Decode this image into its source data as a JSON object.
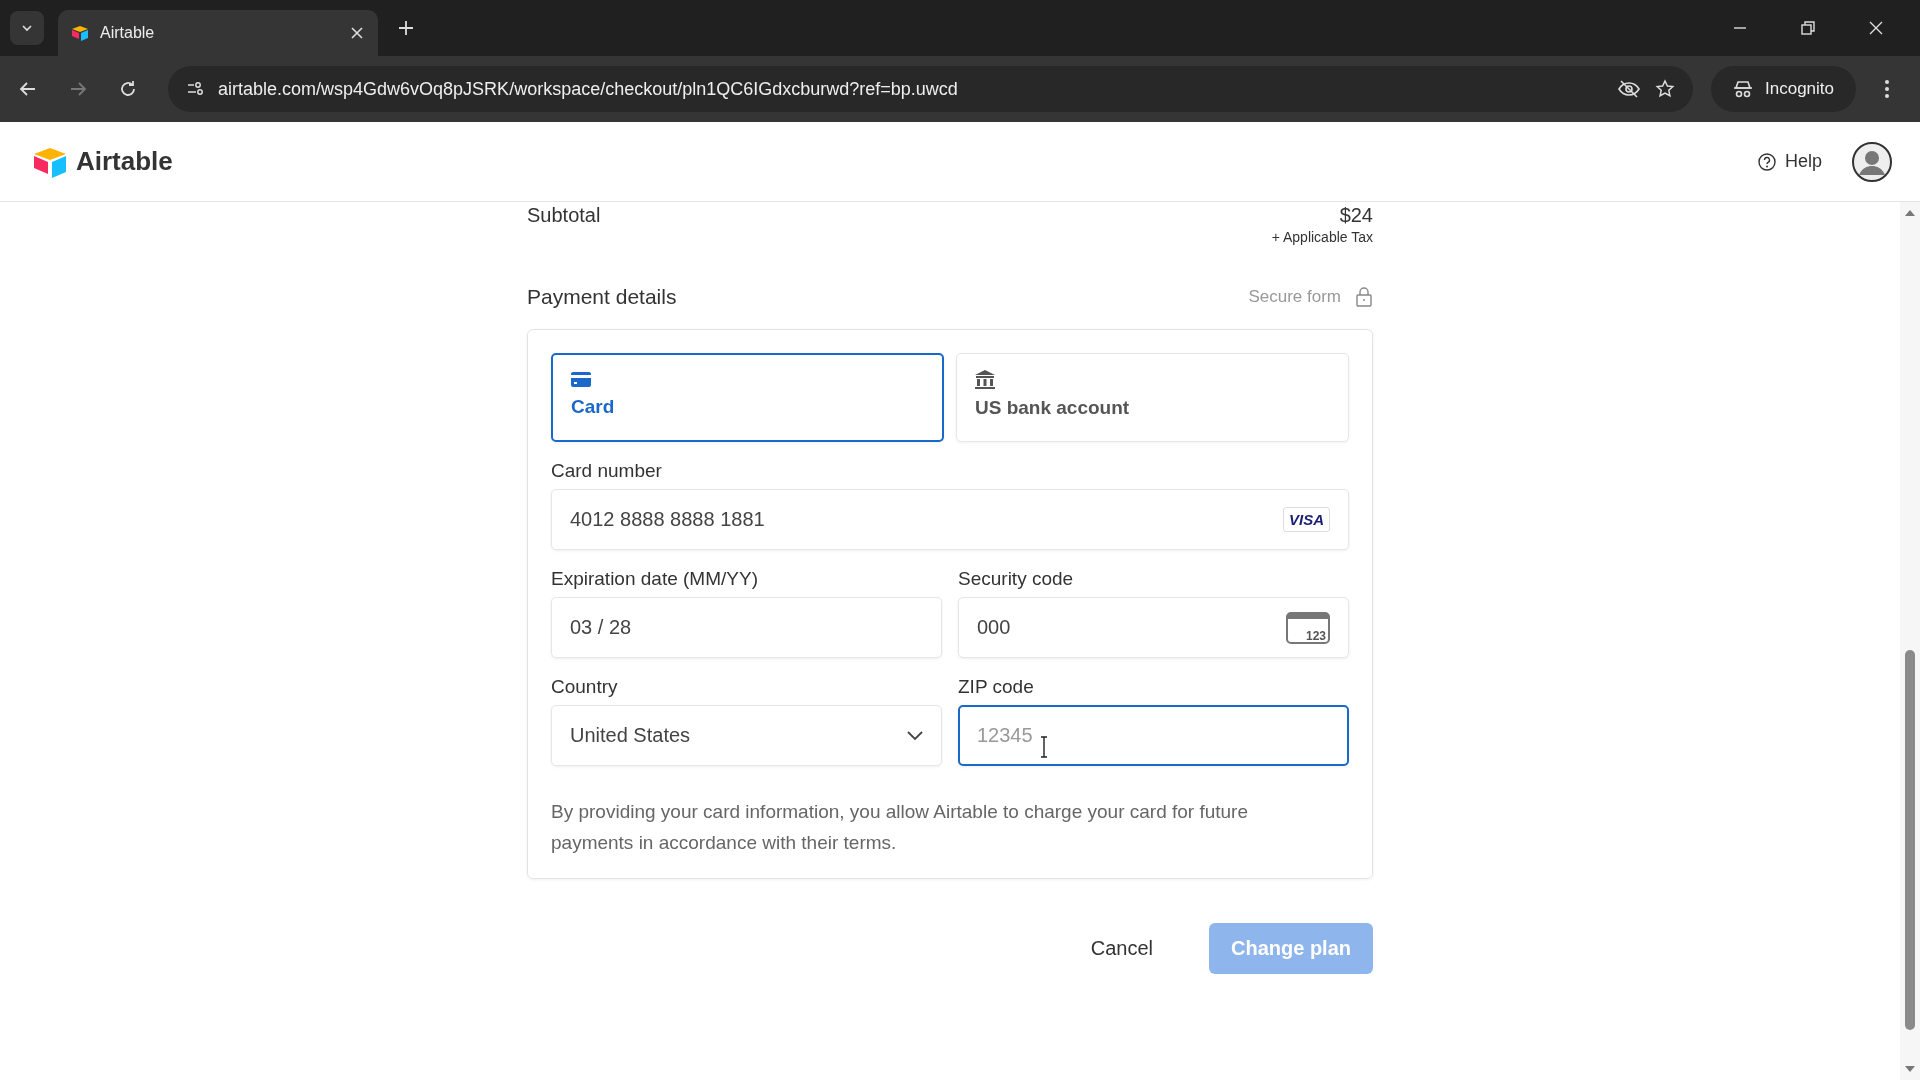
{
  "browser": {
    "tab": {
      "title": "Airtable"
    },
    "url": "airtable.com/wsp4Gdw6vOq8pJSRK/workspace/checkout/pln1QC6IGdxcburwd?ref=bp.uwcd",
    "profile": "Incognito"
  },
  "header": {
    "logo": "Airtable",
    "help": "Help"
  },
  "summary": {
    "label": "Subtotal",
    "amount": "$24",
    "note": "+ Applicable Tax"
  },
  "payment": {
    "title": "Payment details",
    "secure": "Secure form",
    "methods": [
      {
        "kind": "card",
        "label": "Card",
        "selected": true
      },
      {
        "kind": "bank",
        "label": "US bank account",
        "selected": false
      }
    ],
    "rows": [
      [
        {
          "kind": "card-number",
          "label": "Card number",
          "value": "4012 8888 8888 1881",
          "badge": "VISA",
          "focused": false
        }
      ],
      [
        {
          "kind": "text",
          "label": "Expiration date (MM/YY)",
          "value": "03 / 28",
          "focused": false
        },
        {
          "kind": "cvc",
          "label": "Security code",
          "value": "000",
          "badge": "123",
          "focused": false
        }
      ],
      [
        {
          "kind": "select",
          "label": "Country",
          "value": "United States",
          "focused": false
        },
        {
          "kind": "text",
          "label": "ZIP code",
          "placeholder": "12345",
          "focused": true
        }
      ]
    ],
    "terms": "By providing your card information, you allow Airtable to charge your card for future payments in accordance with their terms."
  },
  "actions": [
    {
      "kind": "secondary",
      "label": "Cancel",
      "disabled": false
    },
    {
      "kind": "primary",
      "label": "Change plan",
      "disabled": true
    }
  ]
}
